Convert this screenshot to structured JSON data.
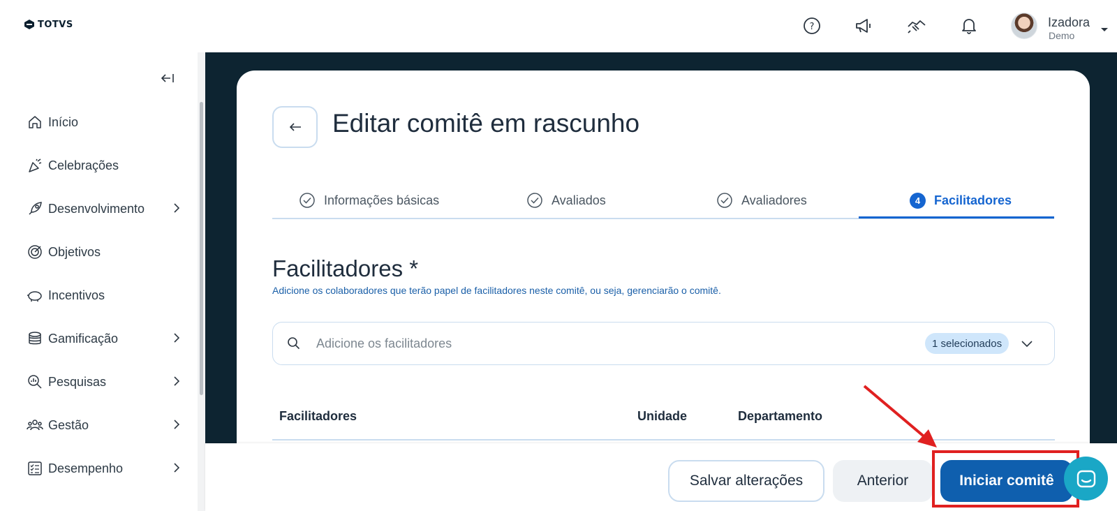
{
  "brand": {
    "logo_text": "TOTVS"
  },
  "header": {
    "icons": [
      "help-icon",
      "megaphone-icon",
      "handshake-icon",
      "bell-icon"
    ],
    "user": {
      "name": "Izadora",
      "role": "Demo"
    }
  },
  "sidebar": {
    "items": [
      {
        "label": "Início",
        "icon": "home-icon",
        "has_submenu": false
      },
      {
        "label": "Celebrações",
        "icon": "party-icon",
        "has_submenu": false
      },
      {
        "label": "Desenvolvimento",
        "icon": "rocket-icon",
        "has_submenu": true
      },
      {
        "label": "Objetivos",
        "icon": "target-icon",
        "has_submenu": false
      },
      {
        "label": "Incentivos",
        "icon": "piggy-bank-icon",
        "has_submenu": false
      },
      {
        "label": "Gamificação",
        "icon": "coins-icon",
        "has_submenu": true
      },
      {
        "label": "Pesquisas",
        "icon": "search-chart-icon",
        "has_submenu": true
      },
      {
        "label": "Gestão",
        "icon": "people-icon",
        "has_submenu": true
      },
      {
        "label": "Desempenho",
        "icon": "checklist-icon",
        "has_submenu": true
      }
    ]
  },
  "page": {
    "title": "Editar comitê em rascunho",
    "steps": [
      {
        "label": "Informações básicas",
        "status": "done"
      },
      {
        "label": "Avaliados",
        "status": "done"
      },
      {
        "label": "Avaliadores",
        "status": "done"
      },
      {
        "label": "Facilitadores",
        "status": "active",
        "number": "4"
      }
    ],
    "section": {
      "title": "Facilitadores *",
      "description": "Adicione os colaboradores que terão papel de facilitadores neste comitê, ou seja, gerenciarão o comitê."
    },
    "search": {
      "placeholder": "Adicione os facilitadores",
      "selected_badge": "1 selecionados"
    },
    "table": {
      "columns": [
        "Facilitadores",
        "Unidade",
        "Departamento"
      ]
    }
  },
  "footer": {
    "save_label": "Salvar alterações",
    "previous_label": "Anterior",
    "start_label": "Iniciar comitê"
  },
  "colors": {
    "primary": "#0f5fae",
    "active_step": "#1565d0",
    "dark_bg": "#0d2431",
    "highlight": "#e02020",
    "chat": "#1aa7c6"
  }
}
